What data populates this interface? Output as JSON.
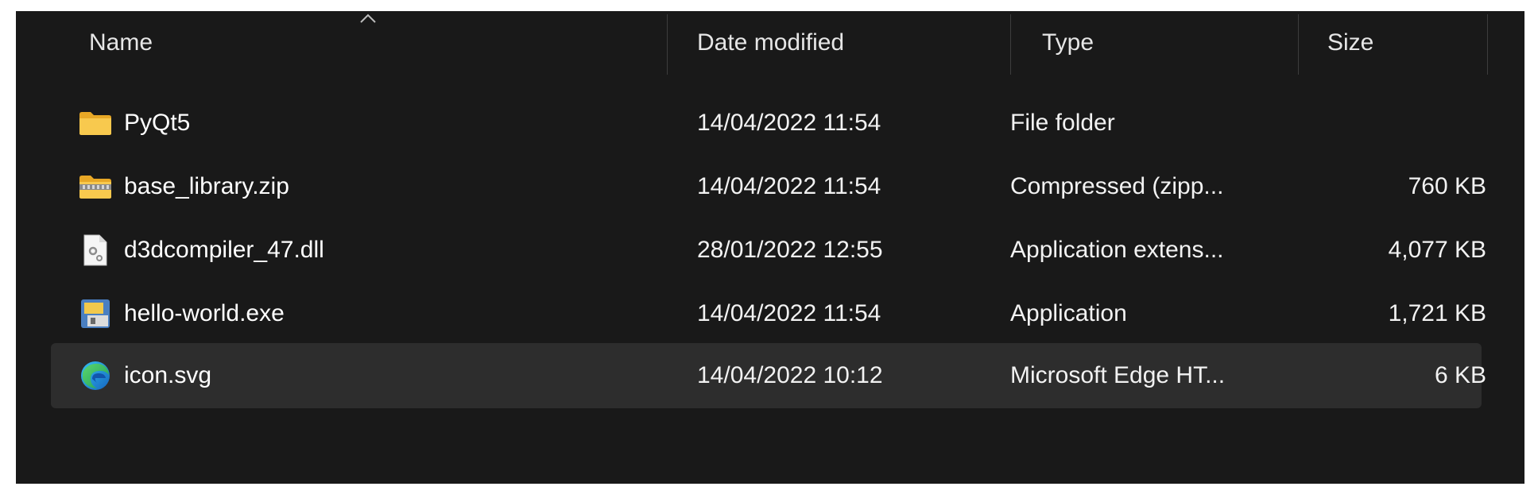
{
  "columns": {
    "name": "Name",
    "date_modified": "Date modified",
    "type": "Type",
    "size": "Size"
  },
  "sort": {
    "column": "name",
    "direction": "ascending",
    "icon": "sort-up-chevron-icon"
  },
  "files": [
    {
      "name": "PyQt5",
      "date": "14/04/2022 11:54",
      "type": "File folder",
      "size": "",
      "icon": "folder-icon"
    },
    {
      "name": "base_library.zip",
      "date": "14/04/2022 11:54",
      "type": "Compressed (zipp...",
      "size": "760 KB",
      "icon": "zip-folder-icon"
    },
    {
      "name": "d3dcompiler_47.dll",
      "date": "28/01/2022 12:55",
      "type": "Application extens...",
      "size": "4,077 KB",
      "icon": "dll-file-icon"
    },
    {
      "name": "hello-world.exe",
      "date": "14/04/2022 11:54",
      "type": "Application",
      "size": "1,721 KB",
      "icon": "python-app-icon"
    },
    {
      "name": "icon.svg",
      "date": "14/04/2022 10:12",
      "type": "Microsoft Edge HT...",
      "size": "6 KB",
      "icon": "edge-icon"
    }
  ],
  "colors": {
    "background": "#191919",
    "hover_row": "#2d2d2d",
    "text": "#ffffff",
    "divider": "#3d3d3d",
    "folder": "#f8c34a"
  }
}
